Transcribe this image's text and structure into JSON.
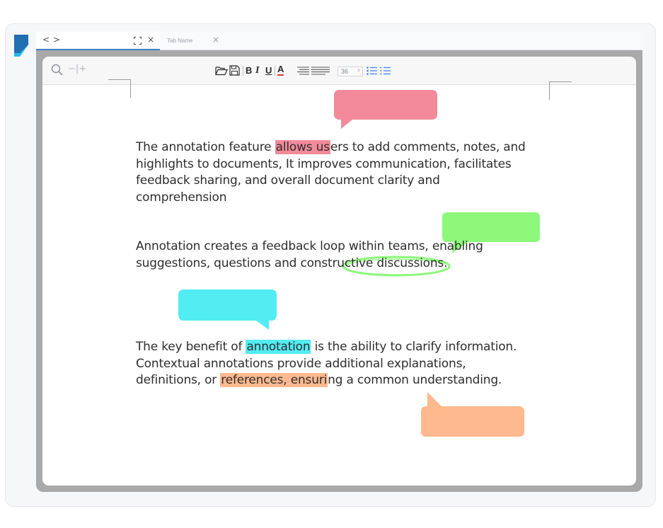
{
  "colors": {
    "tab_accent": "#3b82c4",
    "annotation_red": "#f28a9b",
    "annotation_green": "#8ef87b",
    "annotation_cyan": "#52ecf3",
    "annotation_orange": "#ffb98e",
    "font_color_red": "#e23a3a",
    "list_icon_blue": "#3b82f6"
  },
  "tabs": {
    "back_label": "<",
    "forward_label": ">",
    "active": {
      "expand_icon": "expand-icon",
      "close_label": "×"
    },
    "inactive": {
      "title": "Tab Name",
      "close_label": "×"
    }
  },
  "toolbar": {
    "search_icon": "search-icon",
    "zoom_label": "−|+",
    "open_icon": "folder-open-icon",
    "save_icon": "save-icon",
    "bold_label": "B",
    "italic_label": "I",
    "underline_label": "U",
    "font_color_label": "A",
    "align_icon": "align-icon",
    "justify_icon": "justify-icon",
    "font_size": "36",
    "font_size_caret": "v",
    "bullet_list_icon": "bullet-list-icon",
    "numbered_list_icon": "numbered-list-icon"
  },
  "document": {
    "p1": {
      "before": "The annotation feature ",
      "highlight": "allows us",
      "after": "ers to add comments, notes, and highlights to documents, It improves communication, facilitates feedback sharing, and overall document clarity and comprehension"
    },
    "p2": {
      "before": "Annotation creates a feedback loop within teams, enabling suggestions, questions ",
      "circled": "and constructive",
      "after": " discussions."
    },
    "p3": {
      "before": "The key benefit of ",
      "highlight1": "annotation",
      "middle": " is the ability to clarify information. Contextual annotations provide additional explanations, definitions, or ",
      "highlight2": "references, ensuri",
      "after": "ng a common understanding."
    }
  }
}
